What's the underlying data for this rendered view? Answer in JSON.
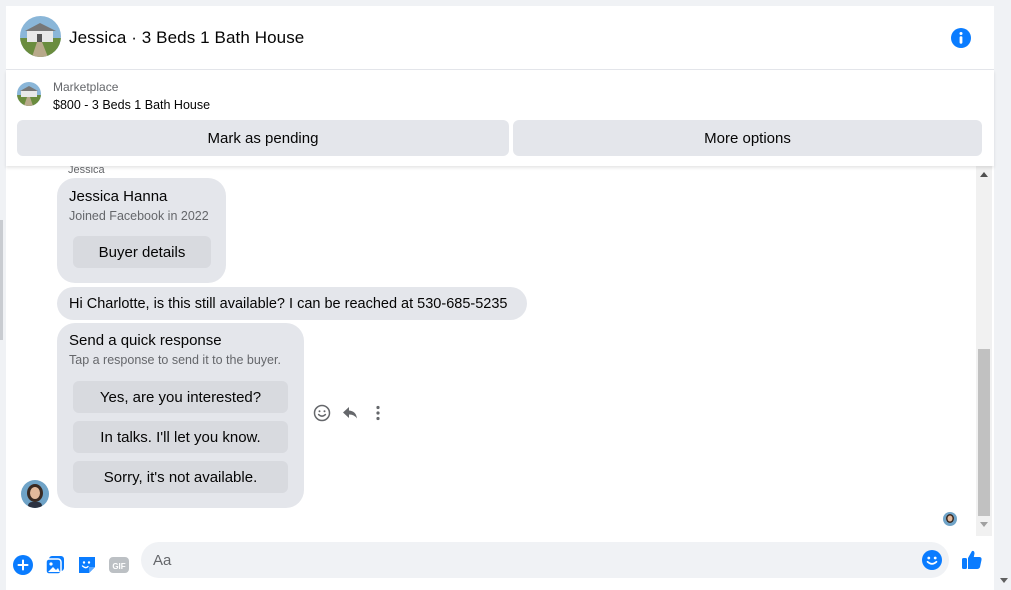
{
  "header": {
    "title": "Jessica · 3 Beds 1 Bath House"
  },
  "listing": {
    "category": "Marketplace",
    "price_title": "$800 - 3 Beds 1 Bath House",
    "mark_pending_label": "Mark as pending",
    "more_options_label": "More options"
  },
  "chat": {
    "sender_name": "Jessica",
    "buyer_card": {
      "name": "Jessica Hanna",
      "joined": "Joined Facebook in 2022",
      "details_label": "Buyer details"
    },
    "message": "Hi Charlotte, is this still available? I can be reached at 530-685-5235",
    "quick_response": {
      "title": "Send a quick response",
      "subtitle": "Tap a response to send it to the buyer.",
      "options": [
        "Yes, are you interested?",
        "In talks. I'll let you know.",
        "Sorry, it's not available."
      ]
    }
  },
  "composer": {
    "placeholder": "Aa",
    "gif_label": "GIF"
  },
  "colors": {
    "accent": "#0a7cff",
    "bubble": "#e4e6eb",
    "secondary_text": "#65676b"
  }
}
